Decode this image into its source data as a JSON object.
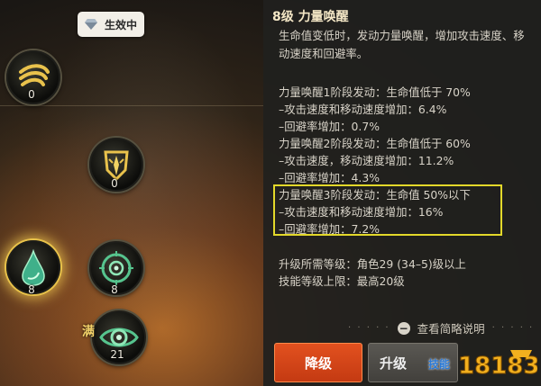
{
  "status_badge": {
    "label": "生效中",
    "icon": "diamond-icon"
  },
  "skills": [
    {
      "id": "spiral",
      "icon": "spiral-icon",
      "count": "0"
    },
    {
      "id": "flame-shield",
      "icon": "flame-shield-icon",
      "count": "0"
    },
    {
      "id": "drop",
      "icon": "drop-icon",
      "count": "8"
    },
    {
      "id": "target",
      "icon": "target-icon",
      "count": "8"
    },
    {
      "id": "eye",
      "icon": "eye-icon",
      "count": "21",
      "tag": "满"
    }
  ],
  "panel": {
    "title": "8级 力量唤醒",
    "description": "生命值变低时，发动力量唤醒，增加攻击速度、移动速度和回避率。",
    "lines": [
      "力量唤醒1阶段发动：生命值低于 70%",
      "–攻击速度和移动速度增加：6.4%",
      "–回避率增加：0.7%",
      "力量唤醒2阶段发动：生命值低于 60%",
      "–攻击速度，移动速度增加：11.2%",
      "–回避率增加：4.3%",
      "力量唤醒3阶段发动：生命值 50%以下",
      "–攻击速度和移动速度增加：16%",
      "–回避率增加：7.2%"
    ],
    "required_level": "升级所需等级：角色29 (34–5)级以上",
    "max_level": "技能等级上限：最高20级",
    "toggle_label": "查看简略说明"
  },
  "buttons": {
    "downgrade": "降级",
    "upgrade": "升级"
  },
  "watermark": {
    "label": "技能",
    "text": "18183"
  },
  "colors": {
    "downgrade": "#d4461a",
    "highlight": "#e3d82a",
    "gold": "#e8c24a"
  }
}
